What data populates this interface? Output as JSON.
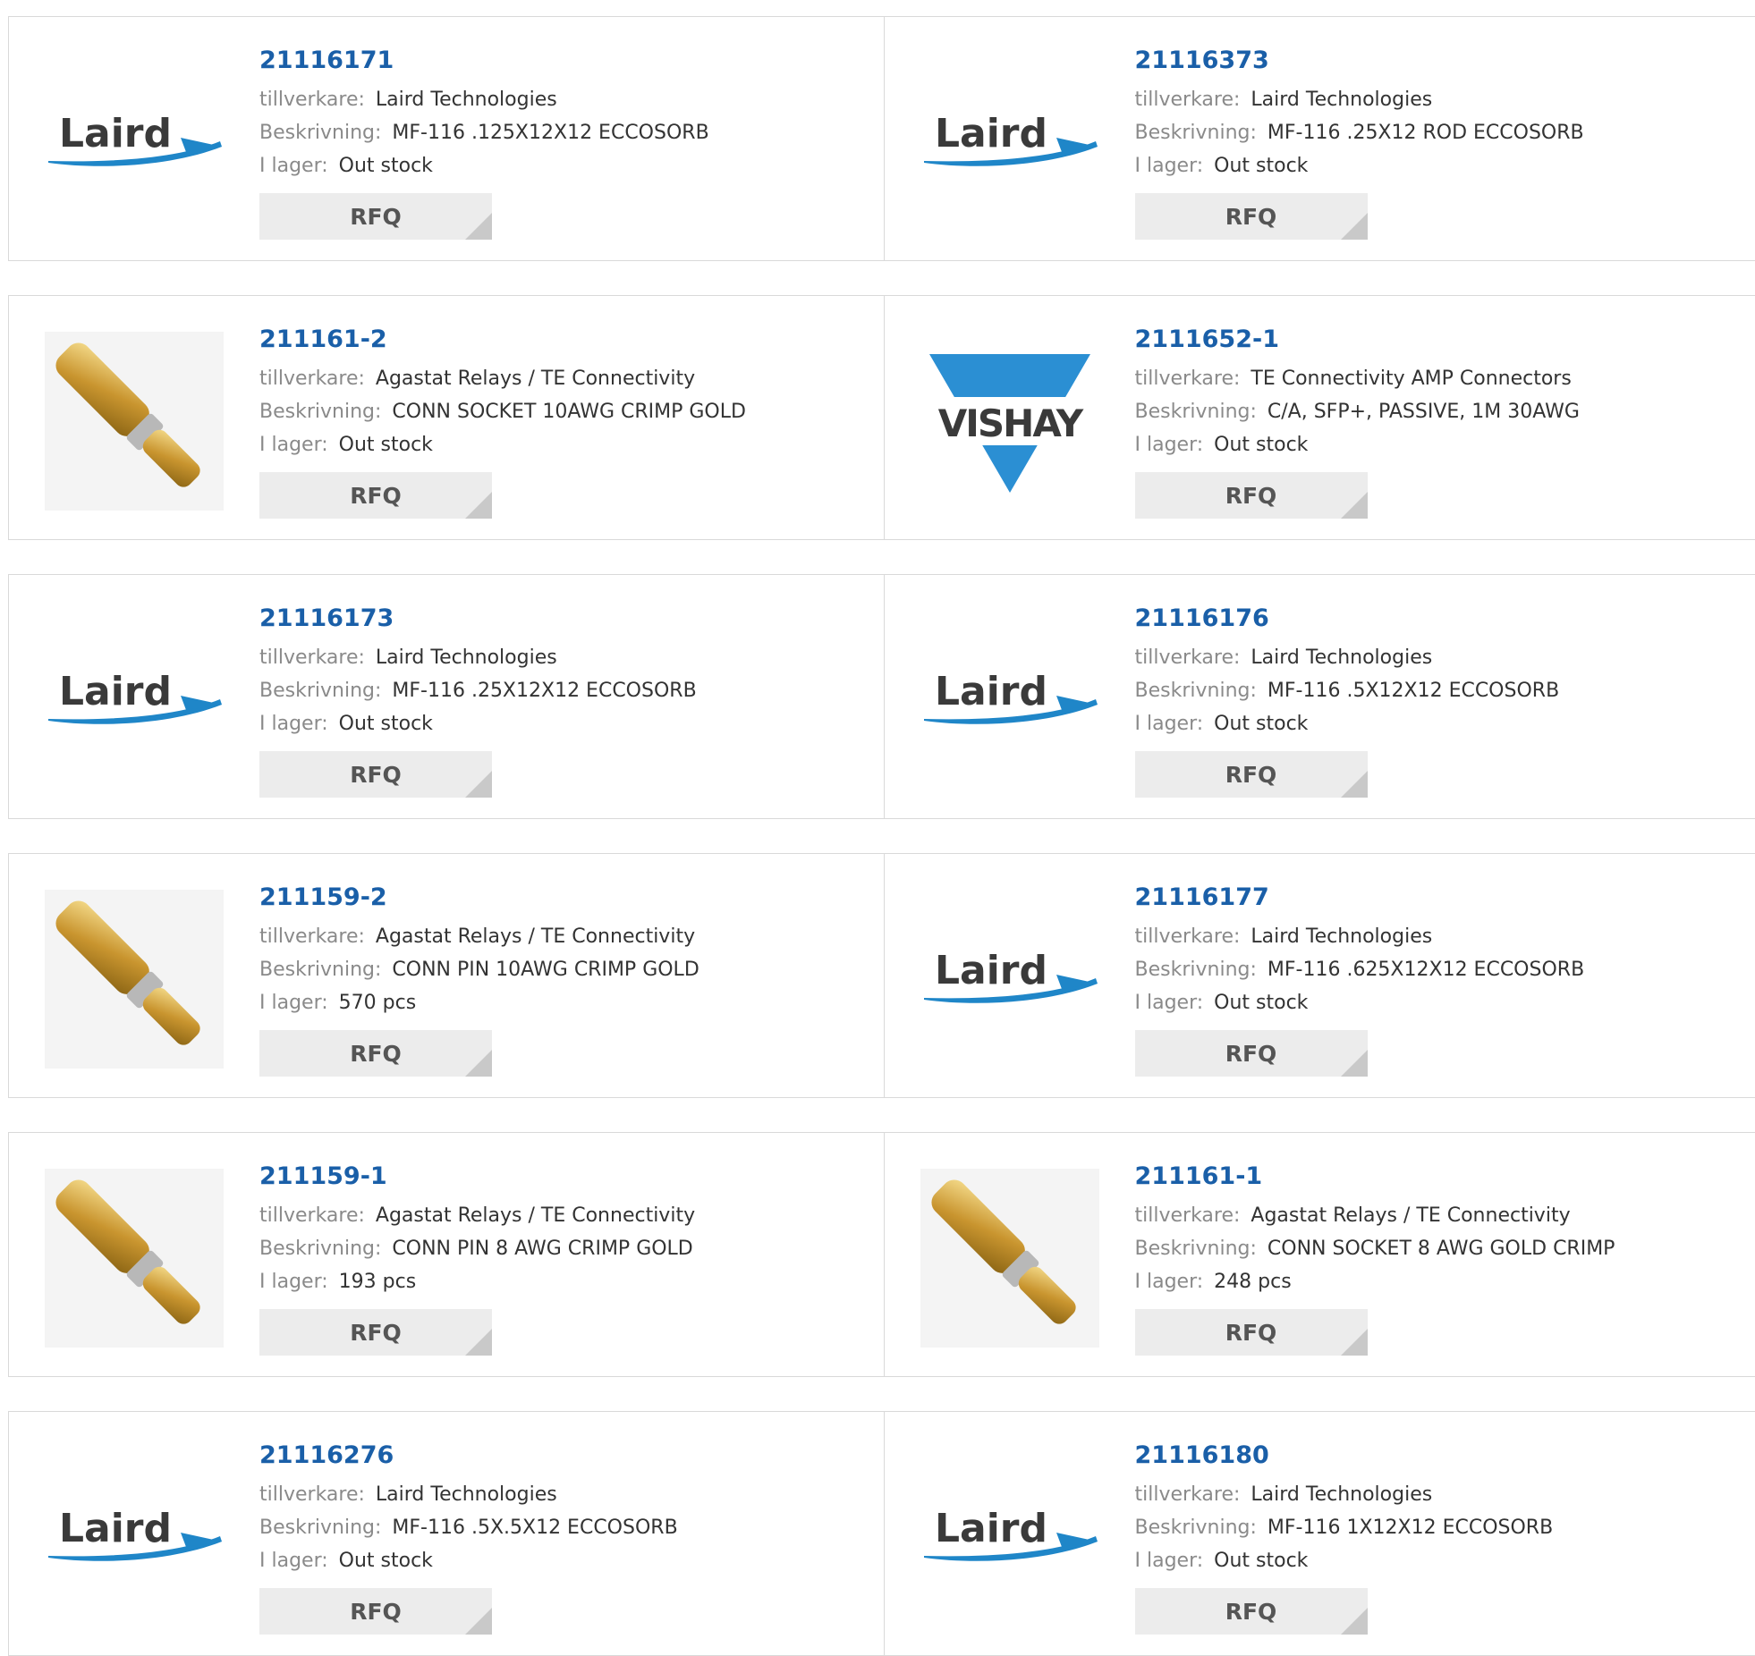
{
  "labels": {
    "manufacturer": "tillverkare:",
    "description": "Beskrivning:",
    "stock": "I lager:",
    "rfq": "RFQ"
  },
  "colors": {
    "link": "#1a5fa8",
    "laird_blue": "#1f86c8",
    "vishay_blue": "#2b8fd3",
    "button_bg": "#ececec"
  },
  "logos": {
    "laird": "Laird",
    "vishay": "VISHAY"
  },
  "products": [
    {
      "part": "21116171",
      "manufacturer": "Laird Technologies",
      "description": "MF-116 .125X12X12 ECCOSORB",
      "stock": "Out stock",
      "image": "laird-logo"
    },
    {
      "part": "21116373",
      "manufacturer": "Laird Technologies",
      "description": "MF-116 .25X12 ROD ECCOSORB",
      "stock": "Out stock",
      "image": "laird-logo"
    },
    {
      "part": "211161-2",
      "manufacturer": "Agastat Relays / TE Connectivity",
      "description": "CONN SOCKET 10AWG CRIMP GOLD",
      "stock": "Out stock",
      "image": "socket-contact-photo"
    },
    {
      "part": "2111652-1",
      "manufacturer": "TE Connectivity AMP Connectors",
      "description": "C/A, SFP+, PASSIVE, 1M 30AWG",
      "stock": "Out stock",
      "image": "vishay-logo"
    },
    {
      "part": "21116173",
      "manufacturer": "Laird Technologies",
      "description": "MF-116 .25X12X12 ECCOSORB",
      "stock": "Out stock",
      "image": "laird-logo"
    },
    {
      "part": "21116176",
      "manufacturer": "Laird Technologies",
      "description": "MF-116 .5X12X12 ECCOSORB",
      "stock": "Out stock",
      "image": "laird-logo"
    },
    {
      "part": "211159-2",
      "manufacturer": "Agastat Relays / TE Connectivity",
      "description": "CONN PIN 10AWG CRIMP GOLD",
      "stock": "570 pcs",
      "image": "pin-contact-photo"
    },
    {
      "part": "21116177",
      "manufacturer": "Laird Technologies",
      "description": "MF-116 .625X12X12 ECCOSORB",
      "stock": "Out stock",
      "image": "laird-logo"
    },
    {
      "part": "211159-1",
      "manufacturer": "Agastat Relays / TE Connectivity",
      "description": "CONN PIN 8 AWG CRIMP GOLD",
      "stock": "193 pcs",
      "image": "pin-contact-photo"
    },
    {
      "part": "211161-1",
      "manufacturer": "Agastat Relays / TE Connectivity",
      "description": "CONN SOCKET 8 AWG GOLD CRIMP",
      "stock": "248 pcs",
      "image": "socket-contact-photo"
    },
    {
      "part": "21116276",
      "manufacturer": "Laird Technologies",
      "description": "MF-116 .5X.5X12 ECCOSORB",
      "stock": "Out stock",
      "image": "laird-logo"
    },
    {
      "part": "21116180",
      "manufacturer": "Laird Technologies",
      "description": "MF-116 1X12X12 ECCOSORB",
      "stock": "Out stock",
      "image": "laird-logo"
    }
  ]
}
